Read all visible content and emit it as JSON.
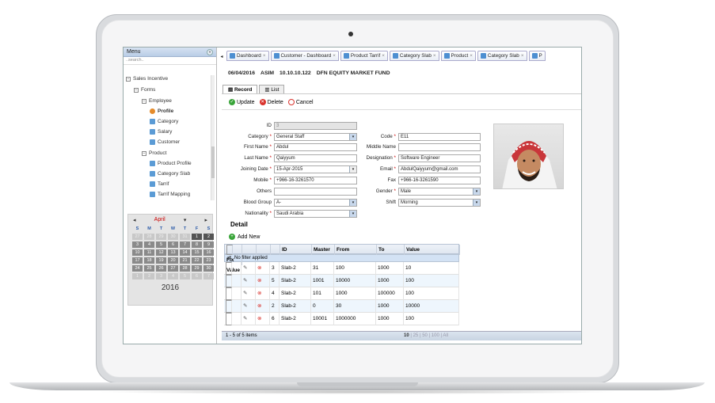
{
  "menu": {
    "title": "Menu",
    "search_placeholder": "..search.."
  },
  "tree": {
    "items": [
      {
        "label": "Sales Incentive",
        "kind": "group"
      },
      {
        "label": "Forms",
        "kind": "group"
      },
      {
        "label": "Employee",
        "kind": "group"
      },
      {
        "label": "Profile",
        "kind": "leaf-person"
      },
      {
        "label": "Category",
        "kind": "leaf"
      },
      {
        "label": "Salary",
        "kind": "leaf"
      },
      {
        "label": "Customer",
        "kind": "leaf"
      },
      {
        "label": "Product",
        "kind": "group"
      },
      {
        "label": "Product Profile",
        "kind": "leaf"
      },
      {
        "label": "Category Slab",
        "kind": "leaf"
      },
      {
        "label": "Tarrif",
        "kind": "leaf"
      },
      {
        "label": "Tarrif Mapping",
        "kind": "leaf"
      }
    ]
  },
  "calendar": {
    "month": "April",
    "year": "2016",
    "dow": [
      "S",
      "M",
      "T",
      "W",
      "T",
      "F",
      "S"
    ],
    "days": [
      "27",
      "28",
      "29",
      "30",
      "31",
      "1",
      "2",
      "3",
      "4",
      "5",
      "6",
      "7",
      "8",
      "9",
      "10",
      "11",
      "12",
      "13",
      "14",
      "15",
      "16",
      "17",
      "18",
      "19",
      "20",
      "21",
      "22",
      "23",
      "24",
      "25",
      "26",
      "27",
      "28",
      "29",
      "30",
      "1",
      "2",
      "3",
      "4",
      "5",
      "6",
      "7"
    ]
  },
  "tabs": [
    "Dashboard",
    "Customer - Dashboard",
    "Product Tarrif",
    "Category Slab",
    "Product",
    "Category Slab",
    "P"
  ],
  "infobar": {
    "date": "06/04/2016",
    "user": "ASIM",
    "ip": "10.10.10.122",
    "fund": "DFN EQUITY MARKET FUND"
  },
  "subtabs": {
    "record": "Record",
    "list": "List"
  },
  "toolbar": {
    "update": "Update",
    "delete": "Delete",
    "cancel": "Cancel"
  },
  "form": {
    "id_label": "ID",
    "id_value": "3",
    "category_label": "Category",
    "category_value": "General Staff",
    "first_name_label": "First Name",
    "first_name_value": "Abdul",
    "last_name_label": "Last Name",
    "last_name_value": "Qaiyyum",
    "joining_date_label": "Joining Date",
    "joining_date_value": "15-Apr-2015",
    "mobile_label": "Mobile",
    "mobile_value": "+966-16-3261570",
    "others_label": "Others",
    "others_value": "",
    "blood_group_label": "Blood Group",
    "blood_group_value": "A-",
    "nationality_label": "Nationality",
    "nationality_value": "Saudi Arabia",
    "code_label": "Code",
    "code_value": "E11",
    "middle_name_label": "Middle Name",
    "middle_name_value": "",
    "designation_label": "Designation",
    "designation_value": "Software Engineer",
    "email_label": "Email",
    "email_value": "AbdulQaiyyum@gmail.com",
    "fax_label": "Fax",
    "fax_value": "+966-16-3261590",
    "gender_label": "Gender",
    "gender_value": "Male",
    "shift_label": "Shift",
    "shift_value": "Morning"
  },
  "detail": {
    "title": "Detail",
    "add_new": "Add New"
  },
  "grid": {
    "headers": [
      "ID",
      "Master",
      "From",
      "To",
      "Value",
      "Fix Value"
    ],
    "filter_text": "No filter applied",
    "rows": [
      [
        "3",
        "Slab-2",
        "31",
        "100",
        "1000",
        "10"
      ],
      [
        "5",
        "Slab-2",
        "1001",
        "10000",
        "1000",
        "100"
      ],
      [
        "4",
        "Slab-2",
        "101",
        "1000",
        "100000",
        "100"
      ],
      [
        "2",
        "Slab-2",
        "0",
        "30",
        "1000",
        "10000"
      ],
      [
        "6",
        "Slab-2",
        "10001",
        "1000000",
        "1000",
        "100"
      ]
    ],
    "footer_count": "1 - 5 of 5 items",
    "page_sizes": [
      "10",
      "25",
      "50",
      "100",
      "All"
    ]
  }
}
